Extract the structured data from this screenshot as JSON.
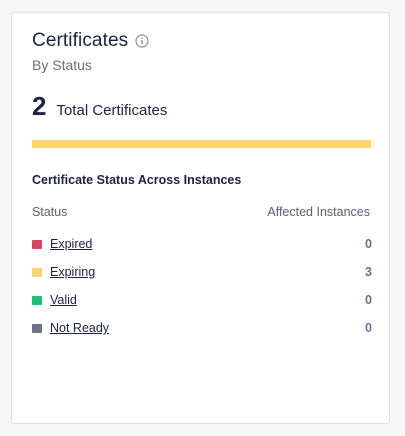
{
  "card": {
    "title": "Certificates",
    "subtitle": "By Status",
    "total_count": "2",
    "total_label": "Total Certificates",
    "progress_fraction": 1.0,
    "progress_color": "#fcd36f",
    "info_icon": "info-circle-icon"
  },
  "section": {
    "heading": "Certificate Status Across Instances",
    "col_status": "Status",
    "col_affected": "Affected Instances"
  },
  "rows": [
    {
      "label": "Expired",
      "count": "0",
      "color": "#d1485f"
    },
    {
      "label": "Expiring",
      "count": "3",
      "color": "#fcd36f"
    },
    {
      "label": "Valid",
      "count": "0",
      "color": "#1bbf7a"
    },
    {
      "label": "Not Ready",
      "count": "0",
      "color": "#6e7386"
    }
  ]
}
